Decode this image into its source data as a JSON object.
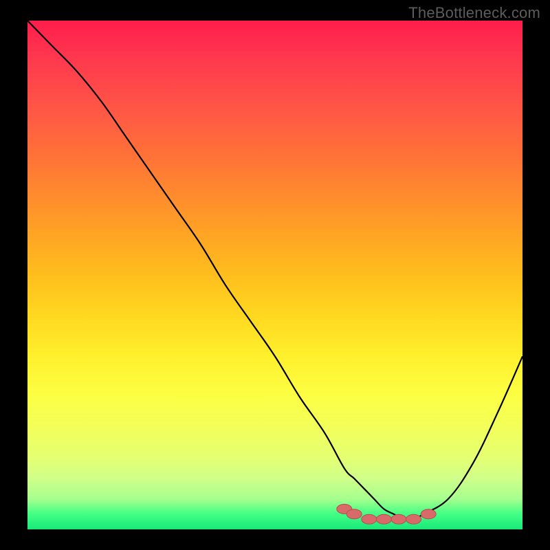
{
  "watermark": "TheBottleneck.com",
  "colors": {
    "background": "#000000",
    "curve_stroke": "#000000",
    "marker_fill": "#d86a6a",
    "marker_stroke": "#b24f4f",
    "watermark_text": "#5d5d5d"
  },
  "chart_data": {
    "type": "line",
    "title": "",
    "xlabel": "",
    "ylabel": "",
    "xlim": [
      0,
      100
    ],
    "ylim": [
      0,
      100
    ],
    "x": [
      0,
      5,
      10,
      15,
      20,
      25,
      30,
      35,
      40,
      45,
      50,
      55,
      60,
      64,
      66,
      68,
      70,
      72,
      74,
      76,
      78,
      80,
      85,
      90,
      95,
      100
    ],
    "values": [
      100,
      95,
      90,
      84,
      77,
      70,
      63,
      56,
      48,
      41,
      34,
      26,
      19,
      12,
      10,
      8,
      6,
      4,
      3,
      2,
      2,
      3,
      6,
      13,
      23,
      34
    ],
    "markers": [
      {
        "x": 64,
        "y": 4
      },
      {
        "x": 66,
        "y": 3
      },
      {
        "x": 69,
        "y": 2
      },
      {
        "x": 72,
        "y": 2
      },
      {
        "x": 75,
        "y": 2
      },
      {
        "x": 78,
        "y": 2
      },
      {
        "x": 81,
        "y": 3
      }
    ]
  }
}
